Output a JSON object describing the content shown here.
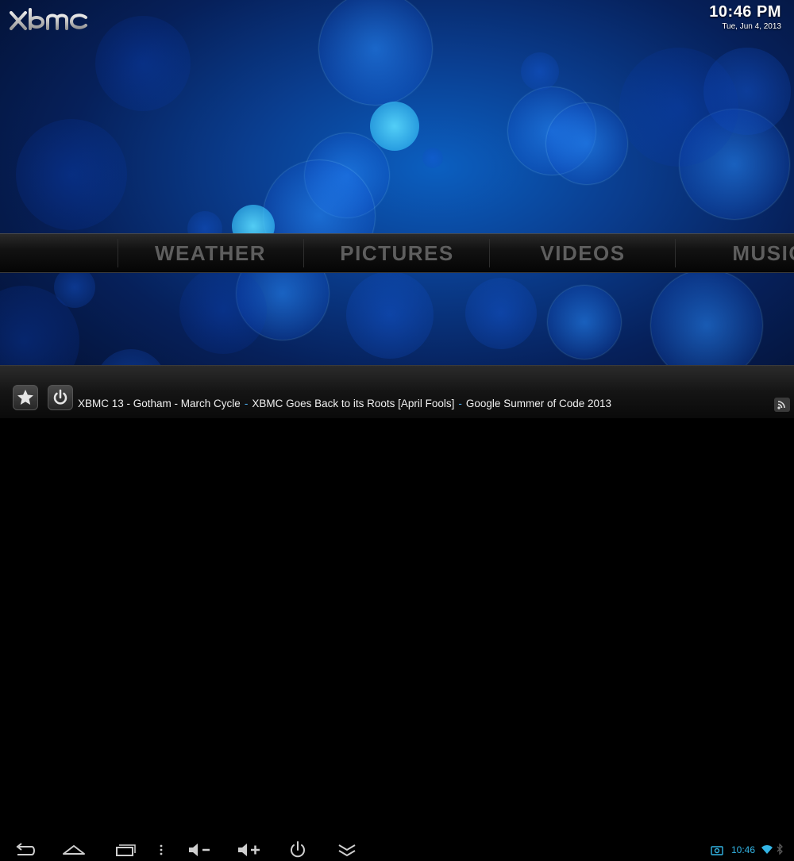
{
  "header": {
    "logo_text": "xbmc",
    "time": "10:46 PM",
    "date": "Tue, Jun 4, 2013"
  },
  "home_menu": {
    "items": [
      {
        "label": "WEATHER"
      },
      {
        "label": "PICTURES"
      },
      {
        "label": "VIDEOS"
      },
      {
        "label": "MUSIC"
      }
    ]
  },
  "ticker": {
    "items": [
      "XBMC 13 - Gotham - March Cycle",
      "XBMC Goes Back to its Roots [April Fools]",
      "Google Summer of Code 2013"
    ],
    "separator": "-"
  },
  "bottom_buttons": {
    "favourites_icon": "star-icon",
    "power_icon": "power-icon"
  },
  "android_navbar": {
    "icons": [
      "back-icon",
      "home-icon",
      "recent-apps-icon",
      "menu-dots-icon",
      "volume-down-icon",
      "volume-up-icon",
      "power-icon",
      "hide-bar-icon"
    ]
  },
  "status_bar": {
    "time": "10:46"
  },
  "colors": {
    "accent": "#33b5e5",
    "menu_text": "#5e5e5e",
    "ticker_separator": "#4aa8e8"
  }
}
